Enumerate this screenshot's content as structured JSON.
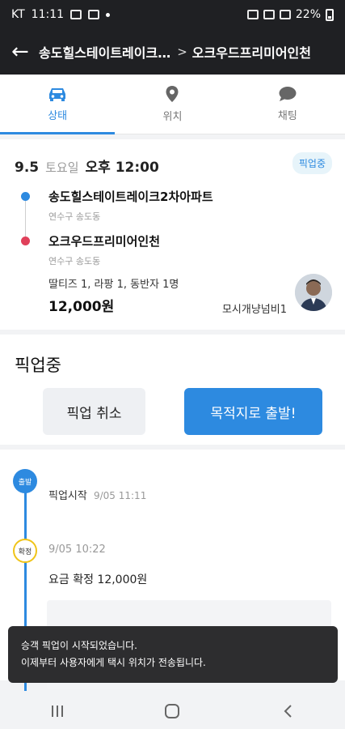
{
  "status_bar": {
    "carrier": "KT",
    "time": "11:11",
    "battery": "22%"
  },
  "header": {
    "from": "송도힐스테이트레이크…",
    "separator": ">",
    "to": "오크우드프리미어인천"
  },
  "tabs": [
    {
      "label": "상태",
      "icon": "car-icon",
      "active": true
    },
    {
      "label": "위치",
      "icon": "location-pin-icon",
      "active": false
    },
    {
      "label": "채팅",
      "icon": "chat-bubble-icon",
      "active": false
    }
  ],
  "trip": {
    "date": "9.5",
    "weekday": "토요일",
    "time": "오후 12:00",
    "status_badge": "픽업중",
    "origin": {
      "name": "송도힐스테이트레이크2차아파트",
      "area": "연수구 송도동",
      "color": "#2d8ae0"
    },
    "destination": {
      "name": "오크우드프리미어인천",
      "area": "연수구 송도동",
      "color": "#e0405a"
    },
    "items": "딸티즈 1, 라팡 1, 동반자 1명",
    "price": "12,000원",
    "passenger": "모시개냥넘비1"
  },
  "pickup": {
    "title": "픽업중",
    "cancel_label": "픽업 취소",
    "depart_label": "목적지로 출발!"
  },
  "timeline": {
    "start_badge": "출발",
    "start_label": "픽업시작",
    "start_time": "9/05 11:11",
    "fixed_badge": "확정",
    "fixed_time": "9/05 10:22",
    "fare_text": "요금 확정 12,000원"
  },
  "toast": {
    "line1": "승객 픽업이 시작되었습니다.",
    "line2": "이제부터 사용자에게 택시 위치가 전송됩니다."
  },
  "colors": {
    "accent": "#2d8ae0",
    "header_bg": "#1f2023",
    "destination_dot": "#e0405a",
    "fixed_ring": "#f0c419"
  }
}
